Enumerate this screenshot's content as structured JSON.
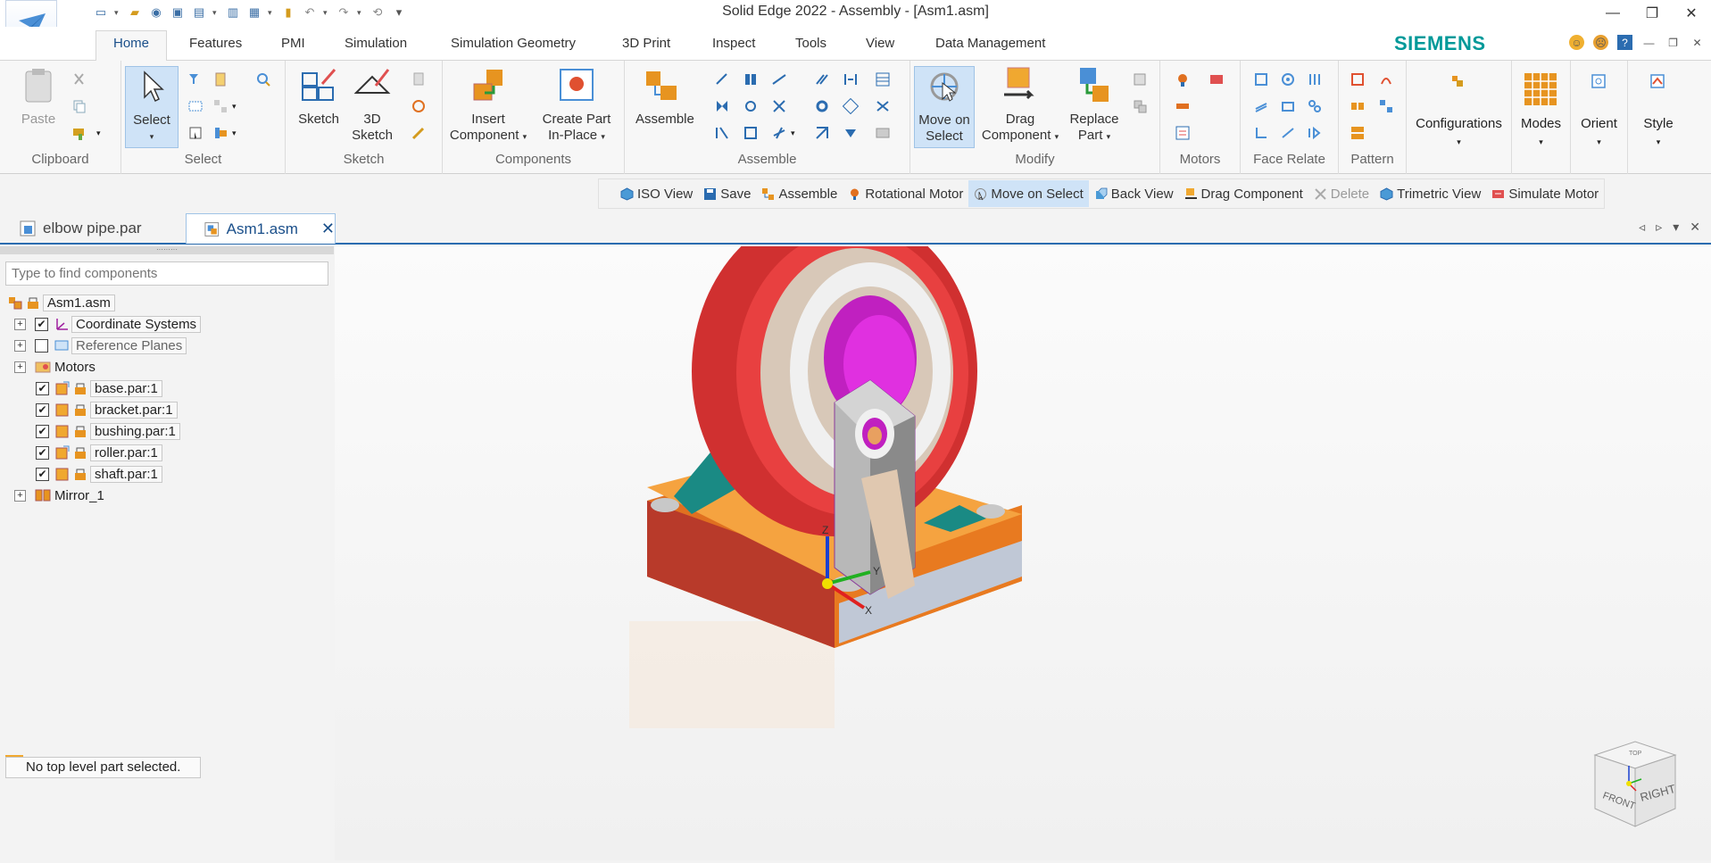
{
  "app": {
    "title": "Solid Edge 2022 - Assembly - [Asm1.asm]",
    "brand": "SIEMENS",
    "brand_color": "#009999"
  },
  "ribbon_tabs": [
    "Home",
    "Features",
    "PMI",
    "Simulation",
    "Simulation Geometry",
    "3D Print",
    "Inspect",
    "Tools",
    "View",
    "Data Management"
  ],
  "ribbon": {
    "clipboard": {
      "label": "Clipboard",
      "paste": "Paste"
    },
    "select": {
      "label": "Select",
      "select": "Select"
    },
    "sketch": {
      "label": "Sketch",
      "sketch": "Sketch",
      "sketch3d_line1": "3D",
      "sketch3d_line2": "Sketch"
    },
    "components": {
      "label": "Components",
      "insert_line1": "Insert",
      "insert_line2": "Component",
      "create_line1": "Create Part",
      "create_line2": "In-Place"
    },
    "assemble": {
      "label": "Assemble",
      "assemble": "Assemble"
    },
    "modify": {
      "label": "Modify",
      "move_line1": "Move on",
      "move_line2": "Select",
      "drag_line1": "Drag",
      "drag_line2": "Component",
      "replace_line1": "Replace",
      "replace_line2": "Part"
    },
    "motors": {
      "label": "Motors"
    },
    "face_relate": {
      "label": "Face Relate"
    },
    "pattern": {
      "label": "Pattern"
    },
    "configurations": {
      "label": "Configurations"
    },
    "modes": {
      "label": "Modes"
    },
    "orient": {
      "label": "Orient"
    },
    "style": {
      "label": "Style"
    }
  },
  "command_bar": [
    {
      "label": "ISO View",
      "icon": "iso-view-icon"
    },
    {
      "label": "Save",
      "icon": "save-icon"
    },
    {
      "label": "Assemble",
      "icon": "assemble-icon"
    },
    {
      "label": "Rotational Motor",
      "icon": "rotational-motor-icon"
    },
    {
      "label": "Move on Select",
      "icon": "move-on-select-icon",
      "active": true
    },
    {
      "label": "Back View",
      "icon": "back-view-icon"
    },
    {
      "label": "Drag Component",
      "icon": "drag-component-icon"
    },
    {
      "label": "Delete",
      "icon": "delete-icon",
      "disabled": true
    },
    {
      "label": "Trimetric View",
      "icon": "trimetric-view-icon"
    },
    {
      "label": "Simulate Motor",
      "icon": "simulate-motor-icon"
    }
  ],
  "doc_tabs": [
    {
      "label": "elbow pipe.par"
    },
    {
      "label": "Asm1.asm",
      "active": true
    }
  ],
  "pathfinder": {
    "search_placeholder": "Type to find components",
    "root": "Asm1.asm",
    "items": [
      {
        "label": "Coordinate Systems",
        "expandable": true,
        "checked": true
      },
      {
        "label": "Reference Planes",
        "expandable": true,
        "checked": false
      },
      {
        "label": "Motors",
        "expandable": true
      },
      {
        "label": "base.par:1",
        "checked": true
      },
      {
        "label": "bracket.par:1",
        "checked": true
      },
      {
        "label": "bushing.par:1",
        "checked": true
      },
      {
        "label": "roller.par:1",
        "checked": true
      },
      {
        "label": "shaft.par:1",
        "checked": true
      },
      {
        "label": "Mirror_1",
        "expandable": true
      }
    ],
    "status": "No top level part selected."
  },
  "view_cube": {
    "front": "FRONT",
    "right": "RIGHT",
    "top": "TOP"
  },
  "triad": {
    "x": "X",
    "y": "Y",
    "z": "Z"
  }
}
